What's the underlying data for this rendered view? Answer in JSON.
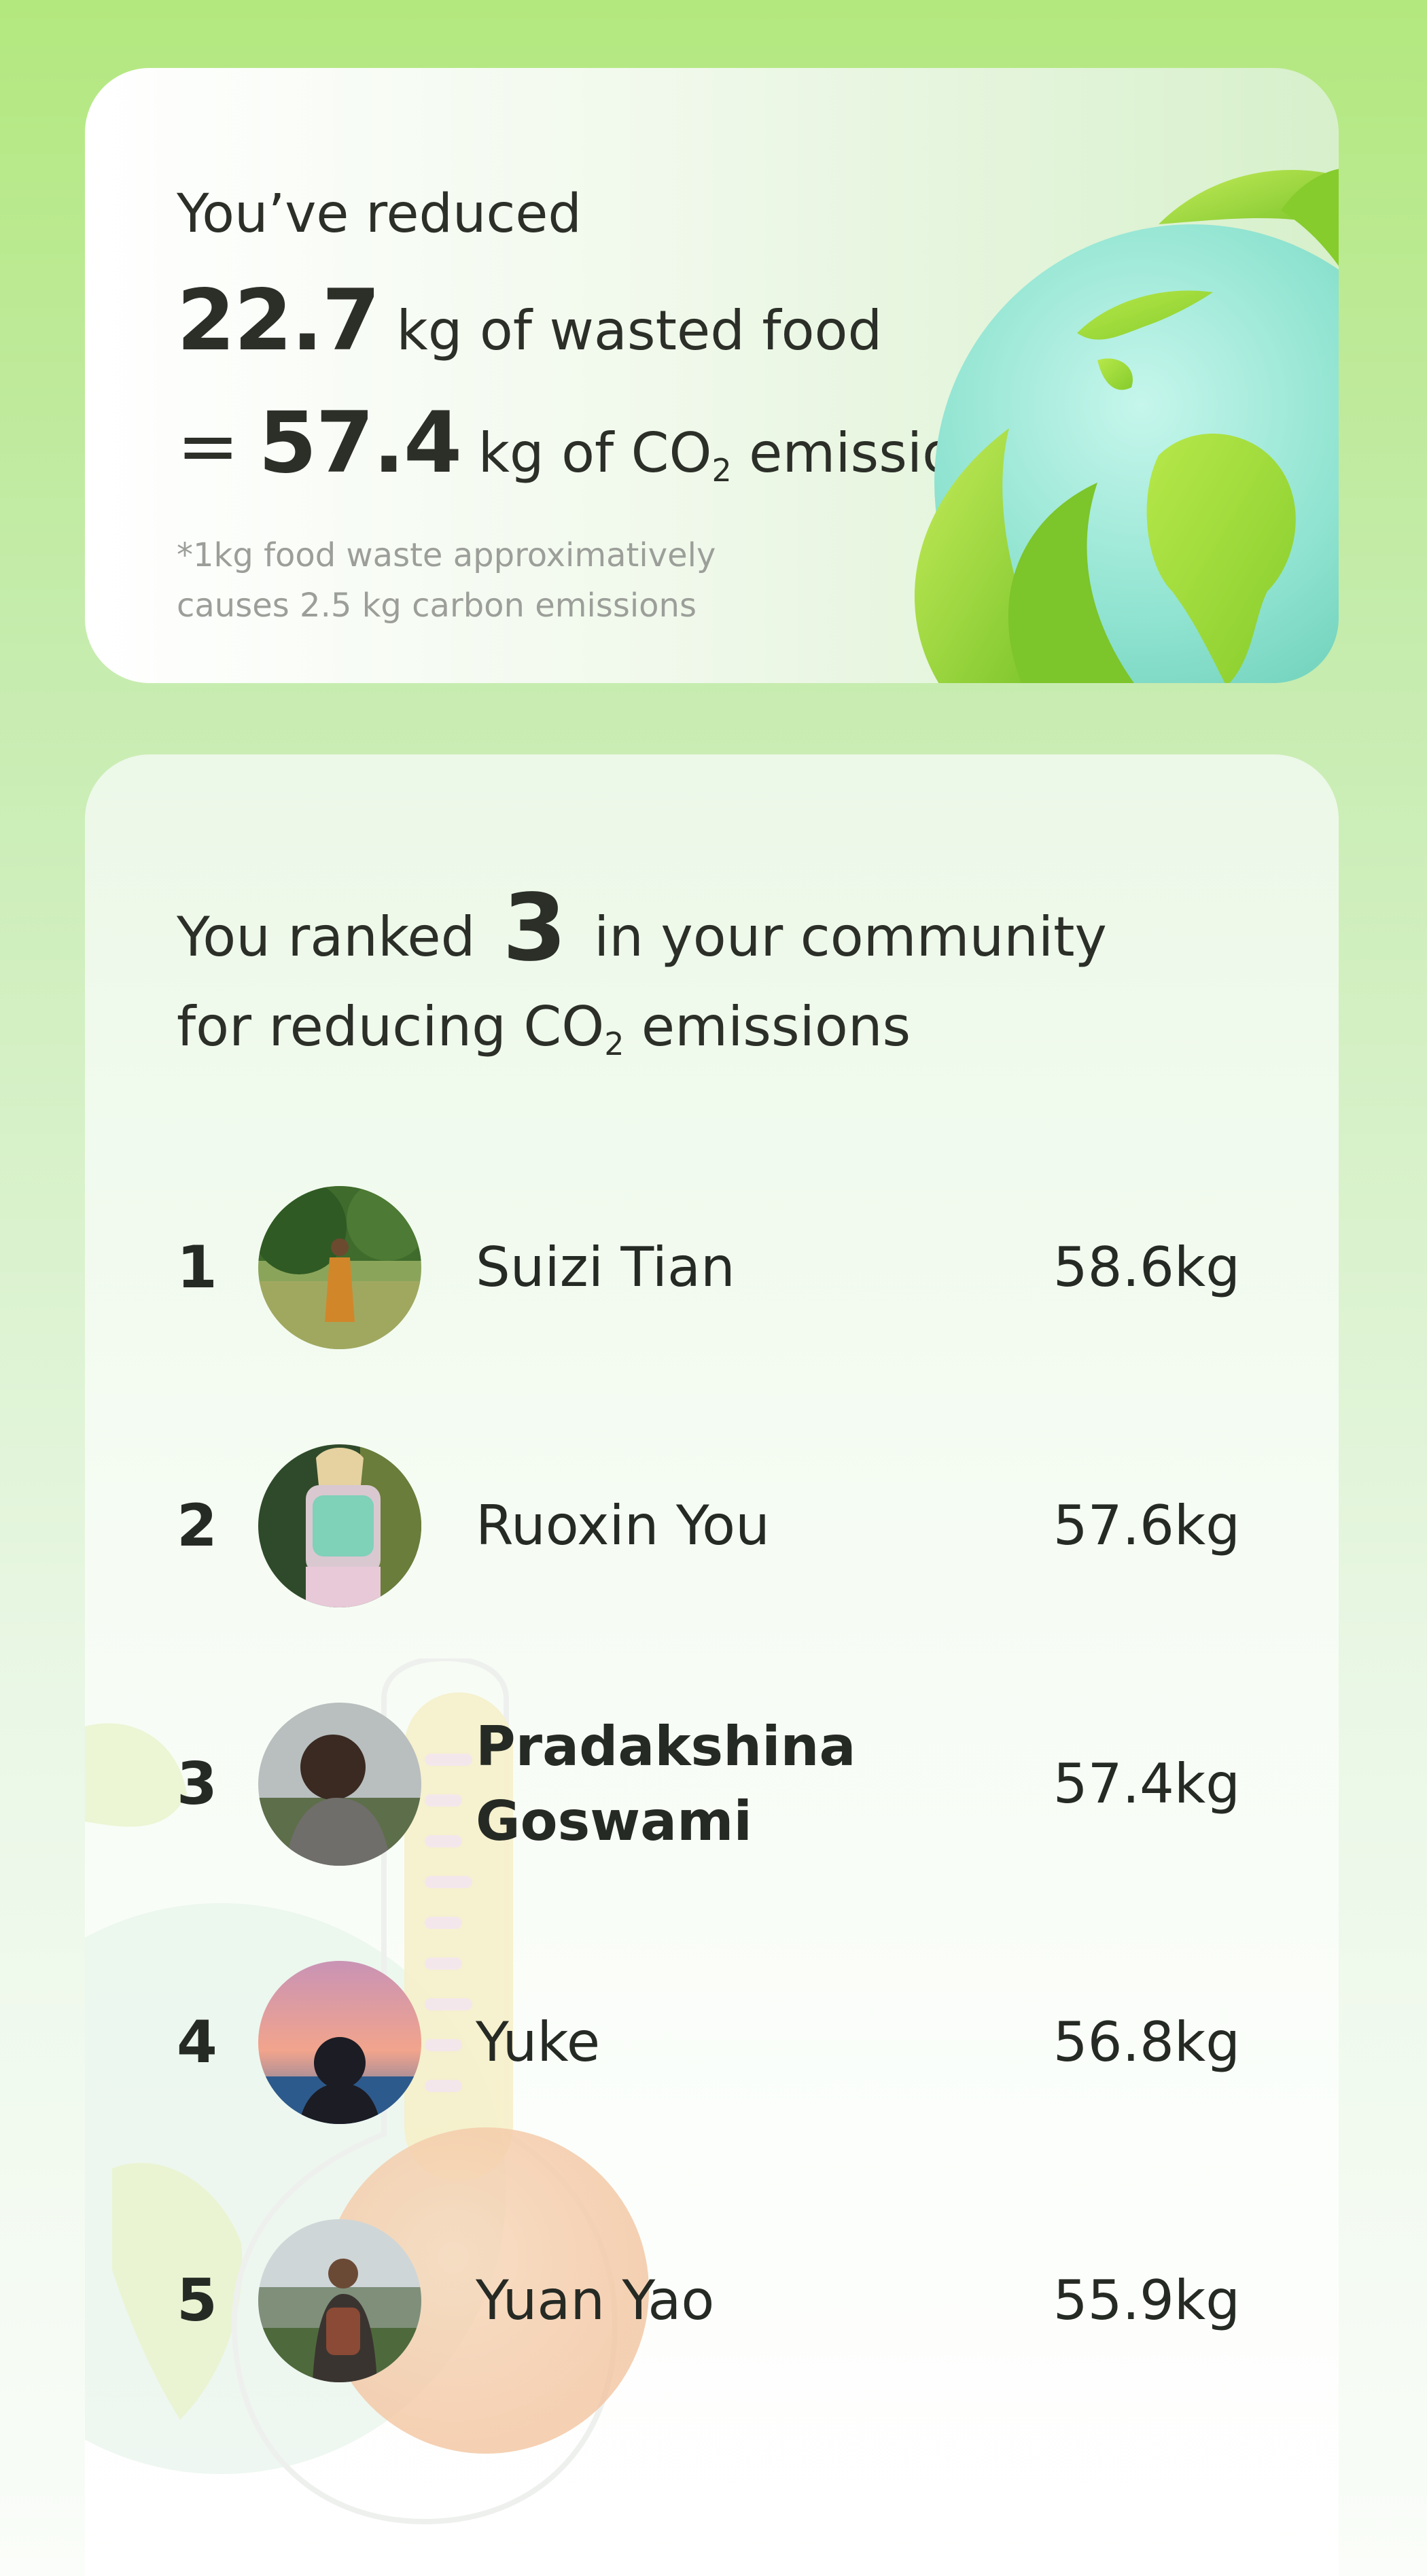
{
  "summary": {
    "intro": "You’ve reduced",
    "food_value": "22.7",
    "food_unit_text": "kg of wasted food",
    "equals": "=",
    "co2_value": "57.4",
    "co2_unit_text": "kg of CO",
    "co2_subscript": "2",
    "co2_suffix": " emissions",
    "footnote": "*1kg food waste approximatively causes 2.5 kg carbon emissions",
    "illustration_icon": "globe-with-leaves-icon"
  },
  "ranking": {
    "prefix": "You ranked",
    "rank": "3",
    "suffix": "in your community",
    "line2_prefix": "for reducing CO",
    "line2_subscript": "2",
    "line2_suffix": " emissions",
    "decoration_icon": "thermometer-icon",
    "entries": [
      {
        "position": "1",
        "name": "Suizi Tian",
        "value": "58.6kg",
        "highlight": false
      },
      {
        "position": "2",
        "name": "Ruoxin You",
        "value": "57.6kg",
        "highlight": false
      },
      {
        "position": "3",
        "name": "Pradakshina Goswami",
        "value": "57.4kg",
        "highlight": true
      },
      {
        "position": "4",
        "name": "Yuke",
        "value": "56.8kg",
        "highlight": false
      },
      {
        "position": "5",
        "name": "Yuan Yao",
        "value": "55.9kg",
        "highlight": false
      }
    ]
  },
  "colors": {
    "background_top": "#b3e87e",
    "text": "#262a24",
    "footnote": "#9c9f99",
    "leaf": "#8fd13a",
    "globe_water": "#8fe3d0"
  }
}
